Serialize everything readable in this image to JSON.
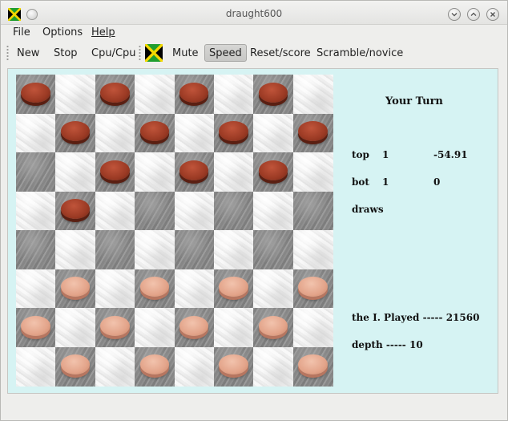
{
  "window": {
    "title": "draught600",
    "controls": [
      "chevron-down-icon",
      "chevron-up-icon",
      "close-icon"
    ]
  },
  "menu": {
    "file": "File",
    "options": "Options",
    "help": "Help"
  },
  "toolbar": {
    "new": "New",
    "stop": "Stop",
    "cpu_cpu": "Cpu/Cpu",
    "mute": "Mute",
    "speed": "Speed",
    "reset_score": "Reset/score",
    "scramble_novice": "Scramble/novice"
  },
  "colors": {
    "panel_background": "#d6f3f3",
    "top_piece": "#9b3a24",
    "bottom_piece": "#e3a48a",
    "flag_green": "#1f9e2f",
    "flag_yellow": "#f4d800",
    "flag_black": "#000000"
  },
  "board": {
    "rows": 8,
    "cols": 8,
    "top_pieces": [
      [
        0,
        0
      ],
      [
        0,
        2
      ],
      [
        0,
        4
      ],
      [
        0,
        6
      ],
      [
        1,
        1
      ],
      [
        1,
        3
      ],
      [
        1,
        5
      ],
      [
        1,
        7
      ],
      [
        2,
        2
      ],
      [
        2,
        4
      ],
      [
        2,
        6
      ],
      [
        3,
        1
      ]
    ],
    "bottom_pieces": [
      [
        5,
        1
      ],
      [
        5,
        3
      ],
      [
        5,
        5
      ],
      [
        5,
        7
      ],
      [
        6,
        0
      ],
      [
        6,
        2
      ],
      [
        6,
        4
      ],
      [
        6,
        6
      ],
      [
        7,
        1
      ],
      [
        7,
        3
      ],
      [
        7,
        5
      ],
      [
        7,
        7
      ]
    ]
  },
  "info": {
    "turn": "Your Turn",
    "top_label": "top",
    "top_value": "1",
    "top_score": "-54.91",
    "bot_label": "bot",
    "bot_value": "1",
    "bot_score": "0",
    "draws_label": "draws",
    "played_label": "the I. Played",
    "played_sep": "-----",
    "played_value": "21560",
    "depth_label": "depth",
    "depth_sep": "-----",
    "depth_value": "10"
  }
}
